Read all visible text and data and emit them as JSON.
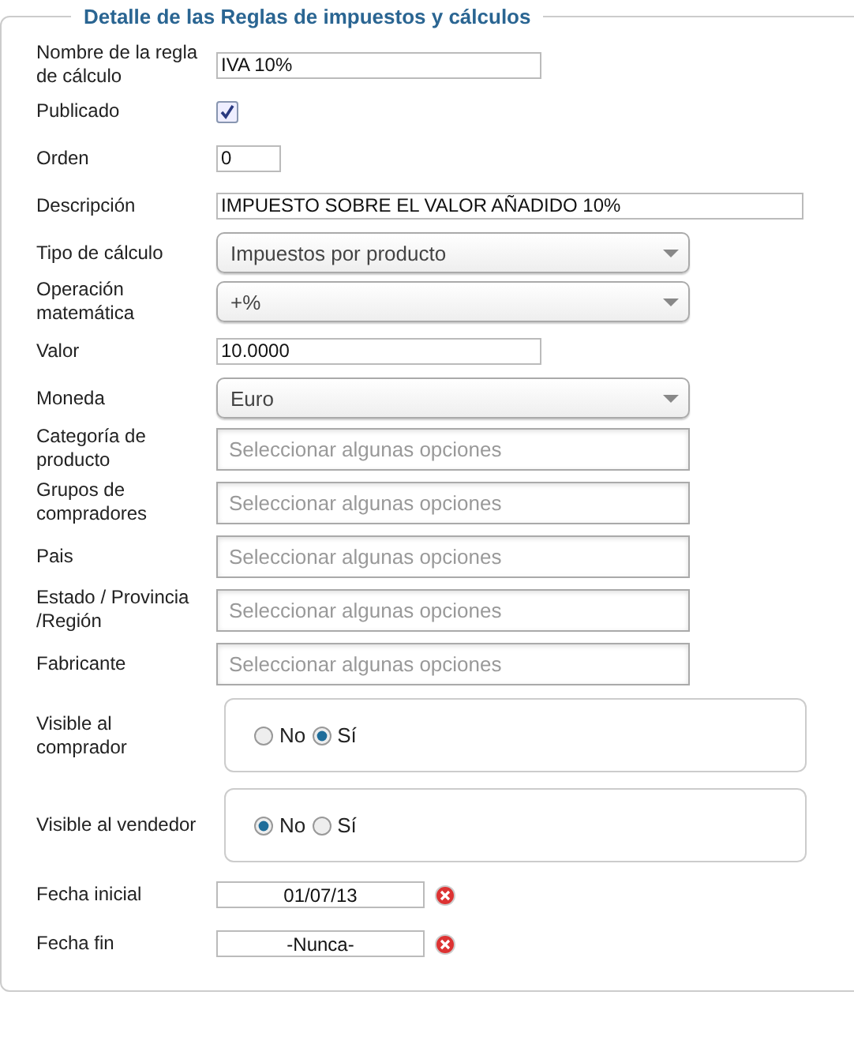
{
  "title": "Detalle de las Reglas de impuestos y cálculos",
  "fields": [
    {
      "kind": "text",
      "label": "Nombre de la regla de cálculo",
      "value": "IVA 10%"
    },
    {
      "kind": "checkbox",
      "label": "Publicado",
      "checked": true
    },
    {
      "kind": "short-text",
      "label": "Orden",
      "value": "0"
    },
    {
      "kind": "long-text",
      "label": "Descripción",
      "value": "IMPUESTO SOBRE EL VALOR AÑADIDO 10%"
    },
    {
      "kind": "select",
      "label": "Tipo de cálculo",
      "value": "Impuestos por producto"
    },
    {
      "kind": "select",
      "label": "Operación matemática",
      "value": "+%"
    },
    {
      "kind": "text",
      "label": "Valor",
      "value": "10.0000"
    },
    {
      "kind": "select",
      "label": "Moneda",
      "value": "Euro"
    },
    {
      "kind": "multiselect",
      "label": "Categoría de producto",
      "placeholder": "Seleccionar algunas opciones"
    },
    {
      "kind": "multiselect",
      "label": "Grupos de compradores",
      "placeholder": "Seleccionar algunas opciones"
    },
    {
      "kind": "multiselect",
      "label": "Pais",
      "placeholder": "Seleccionar algunas opciones"
    },
    {
      "kind": "multiselect",
      "label": "Estado / Provincia /Región",
      "placeholder": "Seleccionar algunas opciones"
    },
    {
      "kind": "multiselect",
      "label": "Fabricante",
      "placeholder": "Seleccionar algunas opciones"
    },
    {
      "kind": "radio",
      "label": "Visible al comprador",
      "options": [
        {
          "label": "No",
          "selected": false
        },
        {
          "label": "Sí",
          "selected": true
        }
      ]
    },
    {
      "kind": "radio",
      "label": "Visible al vendedor",
      "options": [
        {
          "label": "No",
          "selected": true
        },
        {
          "label": "Sí",
          "selected": false
        }
      ]
    },
    {
      "kind": "date",
      "label": "Fecha inicial",
      "value": "01/07/13"
    },
    {
      "kind": "date",
      "label": "Fecha fin",
      "value": "-Nunca-"
    }
  ]
}
